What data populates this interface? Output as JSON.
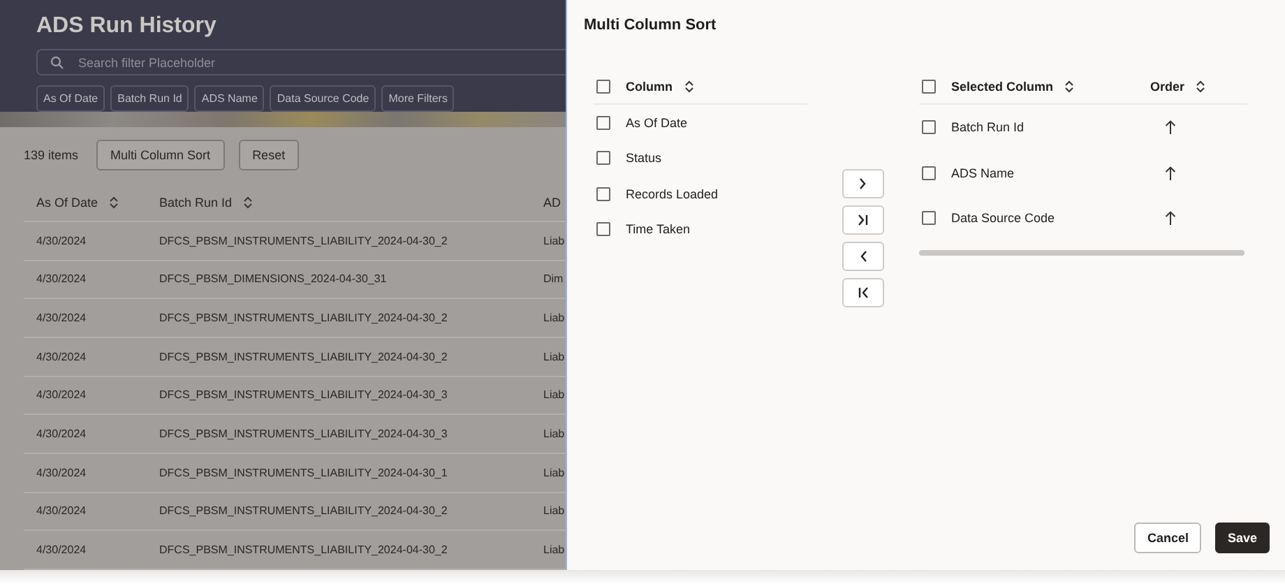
{
  "page": {
    "title": "ADS Run History",
    "search": {
      "placeholder": "Search filter Placeholder"
    },
    "filters": [
      "As Of Date",
      "Batch Run Id",
      "ADS Name",
      "Data Source Code",
      "More Filters"
    ],
    "count": "139 items",
    "buttons": [
      "Multi Column Sort",
      "Reset"
    ],
    "table": {
      "columns": [
        {
          "label": "As Of Date",
          "sortable": true
        },
        {
          "label": "Batch Run Id",
          "sortable": true
        },
        {
          "label": "AD"
        }
      ],
      "rows": [
        [
          "4/30/2024",
          "DFCS_PBSM_INSTRUMENTS_LIABILITY_2024-04-30_2",
          "Liab"
        ],
        [
          "4/30/2024",
          "DFCS_PBSM_DIMENSIONS_2024-04-30_31",
          "Dim"
        ],
        [
          "4/30/2024",
          "DFCS_PBSM_INSTRUMENTS_LIABILITY_2024-04-30_2",
          "Liab"
        ],
        [
          "4/30/2024",
          "DFCS_PBSM_INSTRUMENTS_LIABILITY_2024-04-30_2",
          "Liab"
        ],
        [
          "4/30/2024",
          "DFCS_PBSM_INSTRUMENTS_LIABILITY_2024-04-30_3",
          "Liab"
        ],
        [
          "4/30/2024",
          "DFCS_PBSM_INSTRUMENTS_LIABILITY_2024-04-30_3",
          "Liab"
        ],
        [
          "4/30/2024",
          "DFCS_PBSM_INSTRUMENTS_LIABILITY_2024-04-30_1",
          "Liab"
        ],
        [
          "4/30/2024",
          "DFCS_PBSM_INSTRUMENTS_LIABILITY_2024-04-30_2",
          "Liab"
        ],
        [
          "4/30/2024",
          "DFCS_PBSM_INSTRUMENTS_LIABILITY_2024-04-30_2",
          "Liab"
        ]
      ]
    }
  },
  "dialog": {
    "title": "Multi Column Sort",
    "available": {
      "select_all": {
        "checked": false
      },
      "header": "Column",
      "items": [
        {
          "label": "As Of Date",
          "checked": false
        },
        {
          "label": "Status",
          "checked": false
        },
        {
          "label": "Records Loaded",
          "checked": false
        },
        {
          "label": "Time Taken",
          "checked": false
        }
      ]
    },
    "transfer_buttons": [
      {
        "kind": "add"
      },
      {
        "kind": "add_all"
      },
      {
        "kind": "remove"
      },
      {
        "kind": "remove_all"
      }
    ],
    "selected": {
      "select_all": {
        "checked": false
      },
      "columns": [
        "Selected Column",
        "Order"
      ],
      "items": [
        {
          "label": "Batch Run Id",
          "checked": false,
          "ascending": true
        },
        {
          "label": "ADS Name",
          "checked": false,
          "ascending": true
        },
        {
          "label": "Data Source Code",
          "checked": false,
          "ascending": true
        }
      ]
    },
    "buttons": [
      {
        "label": "Cancel",
        "kind": "secondary"
      },
      {
        "label": "Save",
        "kind": "primary"
      }
    ]
  }
}
